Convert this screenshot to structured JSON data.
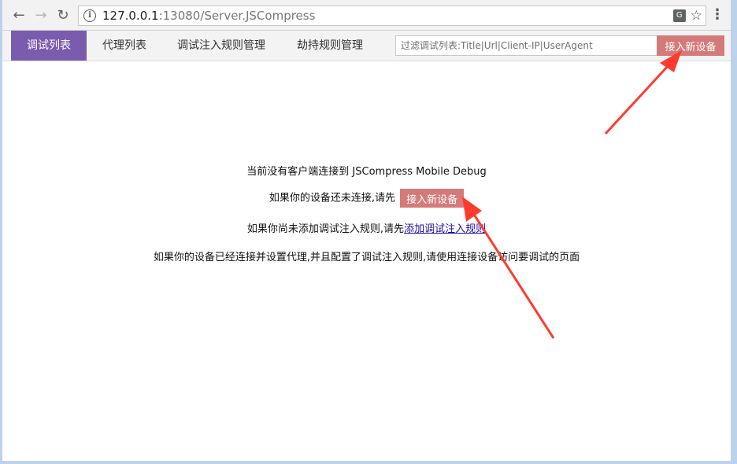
{
  "browser": {
    "url_host": "127.0.0.1",
    "url_rest": ":13080/Server.JSCompress",
    "back_icon": "back-arrow-icon",
    "forward_icon": "forward-arrow-icon",
    "reload_icon": "reload-icon",
    "info_icon": "info-icon",
    "translate_icon": "translate-icon",
    "bookmark_icon": "star-icon",
    "menu_icon": "kebab-menu-icon"
  },
  "nav": {
    "tabs": [
      {
        "label": "调试列表",
        "active": true
      },
      {
        "label": "代理列表",
        "active": false
      },
      {
        "label": "调试注入规则管理",
        "active": false
      },
      {
        "label": "劫持规则管理",
        "active": false
      }
    ],
    "filter_placeholder": "过滤调试列表:Title|Url|Client-IP|UserAgent",
    "connect_button": "接入新设备"
  },
  "main": {
    "line1": "当前没有客户端连接到 JSCompress Mobile Debug",
    "line2_prefix": "如果你的设备还未连接,请先",
    "line2_button": "接入新设备",
    "line3_prefix": "如果你尚未添加调试注入规则,请先",
    "line3_link": "添加调试注入规则",
    "line4": "如果你的设备已经连接并设置代理,并且配置了调试注入规则,请使用连接设备访问要调试的页面"
  },
  "colors": {
    "active_tab": "#7a5cae",
    "connect_button": "#d57a7a",
    "annotation_arrow": "#ff3b2f"
  }
}
